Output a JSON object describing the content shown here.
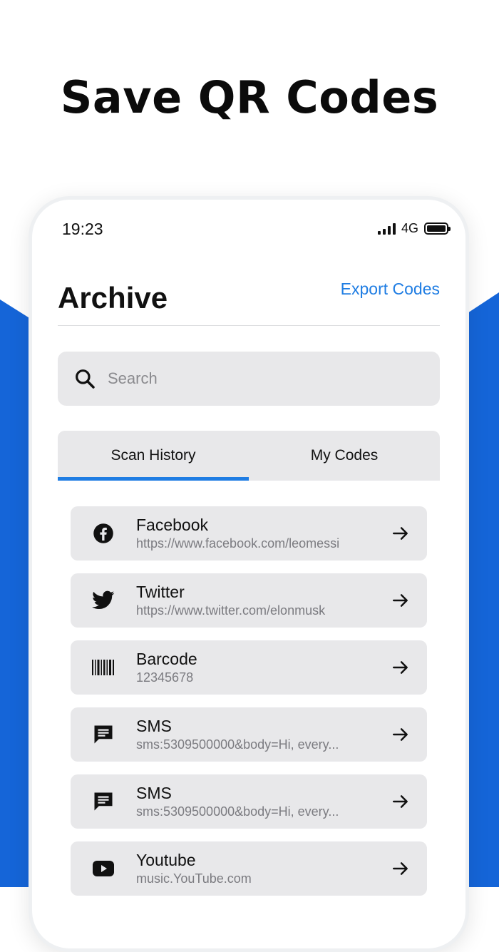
{
  "headline": "Save QR Codes",
  "colors": {
    "accent": "#1f7de3",
    "background_blue": "#1565d8"
  },
  "status": {
    "time": "19:23",
    "network": "4G"
  },
  "header": {
    "title": "Archive",
    "export_label": "Export Codes"
  },
  "search": {
    "placeholder": "Search"
  },
  "tabs": [
    {
      "label": "Scan History",
      "active": true
    },
    {
      "label": "My Codes",
      "active": false
    }
  ],
  "items": [
    {
      "icon": "facebook-icon",
      "title": "Facebook",
      "subtitle": "https://www.facebook.com/leomessi"
    },
    {
      "icon": "twitter-icon",
      "title": "Twitter",
      "subtitle": "https://www.twitter.com/elonmusk"
    },
    {
      "icon": "barcode-icon",
      "title": "Barcode",
      "subtitle": "12345678"
    },
    {
      "icon": "sms-icon",
      "title": "SMS",
      "subtitle": "sms:5309500000&body=Hi, every..."
    },
    {
      "icon": "sms-icon",
      "title": "SMS",
      "subtitle": "sms:5309500000&body=Hi, every..."
    },
    {
      "icon": "youtube-icon",
      "title": "Youtube",
      "subtitle": "music.YouTube.com"
    }
  ]
}
